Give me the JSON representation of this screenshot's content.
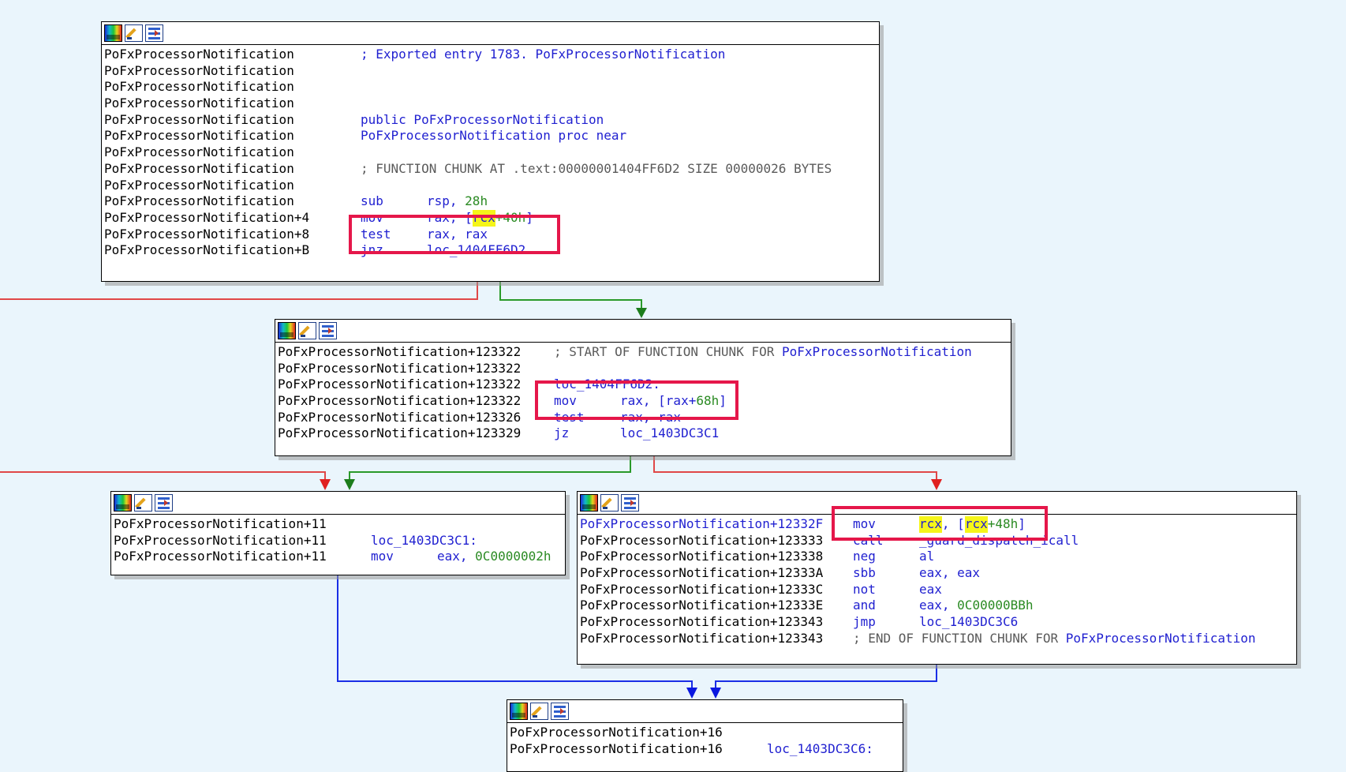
{
  "colors": {
    "background": "#eaf5fc",
    "edge_true": "#2a9a2a",
    "edge_false": "#e04848",
    "edge_uncond": "#1a2ee6",
    "highlight_box": "#e5174a",
    "highlight_fill": "#f5f519"
  },
  "icons": [
    "graph-overview-icon",
    "edit-icon",
    "xrefs-icon"
  ],
  "block1": {
    "lines": [
      {
        "addr": "PoFxProcessorNotification",
        "c1": "; Exported entry 1783. PoFxProcessorNotification"
      },
      {
        "addr": "PoFxProcessorNotification"
      },
      {
        "addr": "PoFxProcessorNotification"
      },
      {
        "addr": "PoFxProcessorNotification"
      },
      {
        "addr": "PoFxProcessorNotification",
        "c1": "public PoFxProcessorNotification"
      },
      {
        "addr": "PoFxProcessorNotification",
        "c1": "PoFxProcessorNotification proc near"
      },
      {
        "addr": "PoFxProcessorNotification"
      },
      {
        "addr": "PoFxProcessorNotification",
        "c1": "; FUNCTION CHUNK AT .text:00000001404FF6D2 SIZE 00000026 BYTES"
      },
      {
        "addr": "PoFxProcessorNotification"
      },
      {
        "addr": "PoFxProcessorNotification",
        "mn": "sub",
        "o1": "rsp, ",
        "o2": "28h"
      },
      {
        "addr": "PoFxProcessorNotification+4",
        "mn": "mov",
        "o1": "rax, [",
        "hl": "rcx",
        "o2": "+40h",
        "o3": "]"
      },
      {
        "addr": "PoFxProcessorNotification+8",
        "mn": "test",
        "o1": "rax, rax"
      },
      {
        "addr": "PoFxProcessorNotification+B",
        "mn": "jnz",
        "o1": "loc_1404FF6D2"
      }
    ]
  },
  "block2": {
    "lines": [
      {
        "addr": "PoFxProcessorNotification+123322",
        "c1": "; START OF FUNCTION CHUNK FOR ",
        "c2": "PoFxProcessorNotification"
      },
      {
        "addr": "PoFxProcessorNotification+123322"
      },
      {
        "addr": "PoFxProcessorNotification+123322",
        "lbl": "loc_1404FF6D2:"
      },
      {
        "addr": "PoFxProcessorNotification+123322",
        "mn": "mov",
        "o1": "rax, [rax+",
        "o2": "68h",
        "o3": "]"
      },
      {
        "addr": "PoFxProcessorNotification+123326",
        "mn": "test",
        "o1": "rax, rax"
      },
      {
        "addr": "PoFxProcessorNotification+123329",
        "mn": "jz",
        "o1": "loc_1403DC3C1"
      }
    ]
  },
  "block3": {
    "lines": [
      {
        "addr": "PoFxProcessorNotification+11"
      },
      {
        "addr": "PoFxProcessorNotification+11",
        "lbl": "loc_1403DC3C1:"
      },
      {
        "addr": "PoFxProcessorNotification+11",
        "mn": "mov",
        "o1": "eax, ",
        "o2": "0C0000002h"
      }
    ]
  },
  "block4": {
    "lines": [
      {
        "addr": "PoFxProcessorNotification+12332F",
        "mn": "mov",
        "hl1": "rcx",
        "o1": ", [",
        "hl2": "rcx",
        "o2": "+48h",
        "o3": "]"
      },
      {
        "addr": "PoFxProcessorNotification+123333",
        "mn": "call",
        "o1": "_guard_dispatch_icall"
      },
      {
        "addr": "PoFxProcessorNotification+123338",
        "mn": "neg",
        "o1": "al"
      },
      {
        "addr": "PoFxProcessorNotification+12333A",
        "mn": "sbb",
        "o1": "eax, eax"
      },
      {
        "addr": "PoFxProcessorNotification+12333C",
        "mn": "not",
        "o1": "eax"
      },
      {
        "addr": "PoFxProcessorNotification+12333E",
        "mn": "and",
        "o1": "eax, ",
        "o2": "0C00000BBh"
      },
      {
        "addr": "PoFxProcessorNotification+123343",
        "mn": "jmp",
        "o1": "loc_1403DC3C6"
      },
      {
        "addr": "PoFxProcessorNotification+123343",
        "c1": "; END OF FUNCTION CHUNK FOR ",
        "c2": "PoFxProcessorNotification"
      }
    ]
  },
  "block5": {
    "lines": [
      {
        "addr": "PoFxProcessorNotification+16"
      },
      {
        "addr": "PoFxProcessorNotification+16",
        "lbl": "loc_1403DC3C6:"
      }
    ]
  }
}
